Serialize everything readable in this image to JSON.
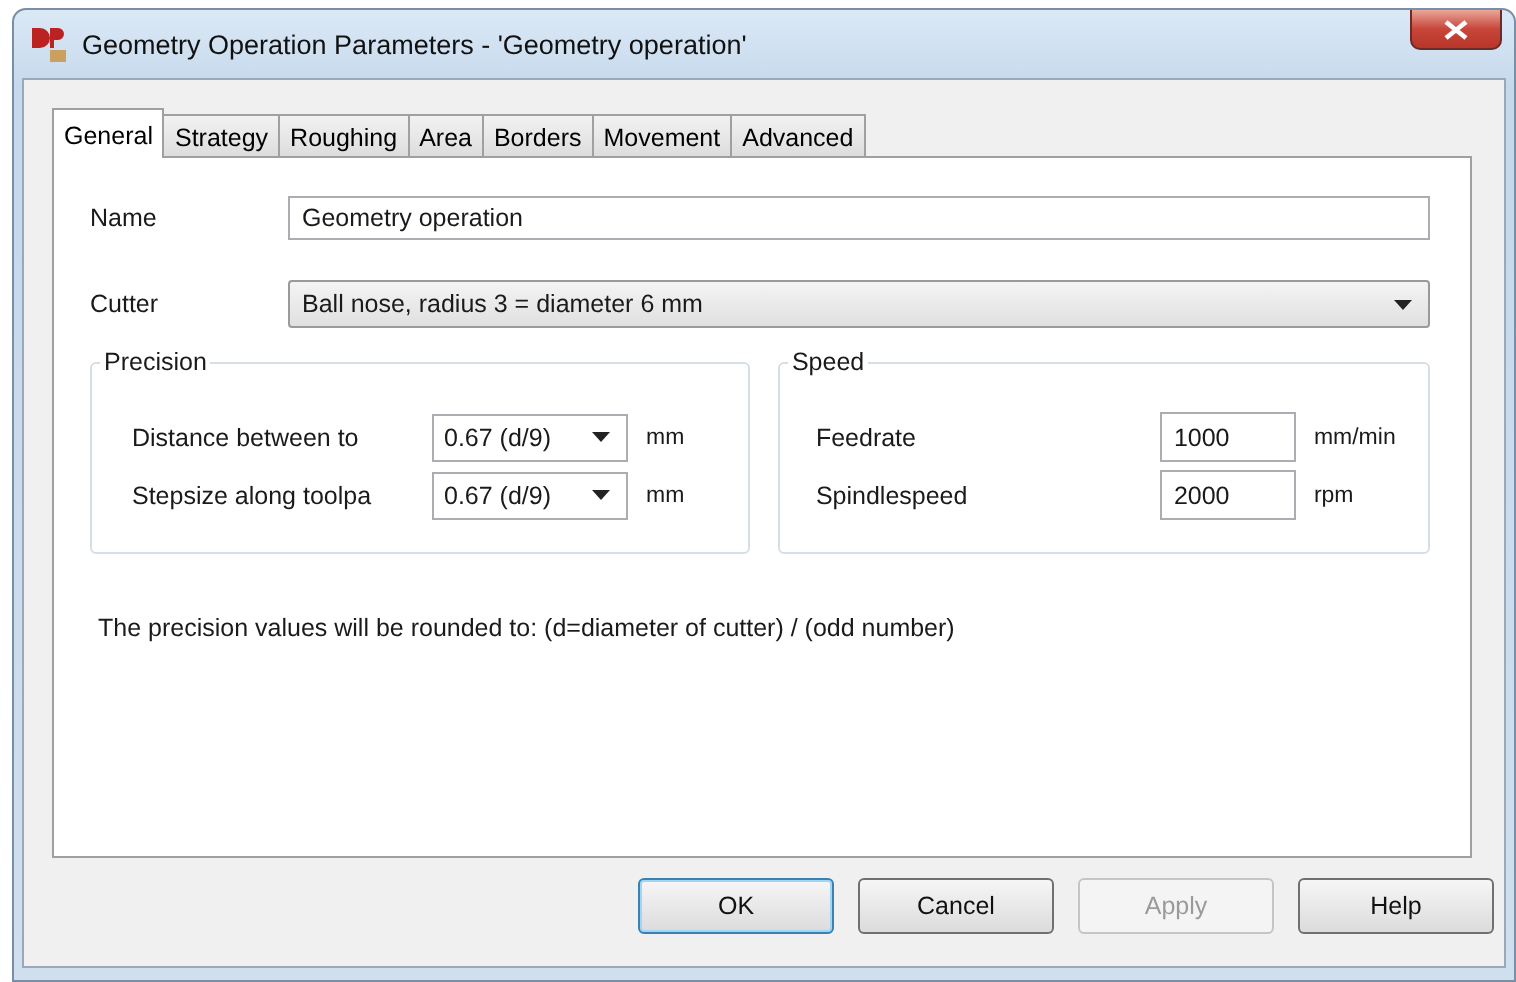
{
  "window": {
    "title": "Geometry Operation Parameters - 'Geometry operation'"
  },
  "tabs": [
    {
      "label": "General",
      "selected": true
    },
    {
      "label": "Strategy",
      "selected": false
    },
    {
      "label": "Roughing",
      "selected": false
    },
    {
      "label": "Area",
      "selected": false
    },
    {
      "label": "Borders",
      "selected": false
    },
    {
      "label": "Movement",
      "selected": false
    },
    {
      "label": "Advanced",
      "selected": false
    }
  ],
  "name": {
    "label": "Name",
    "value": "Geometry operation"
  },
  "cutter": {
    "label": "Cutter",
    "value": "Ball nose, radius 3 = diameter 6 mm"
  },
  "precision": {
    "title": "Precision",
    "rows": [
      {
        "label": "Distance between to",
        "value": "0.67  (d/9)",
        "unit": "mm"
      },
      {
        "label": "Stepsize along toolpa",
        "value": "0.67  (d/9)",
        "unit": "mm"
      }
    ]
  },
  "speed": {
    "title": "Speed",
    "rows": [
      {
        "label": "Feedrate",
        "value": "1000",
        "unit": "mm/min"
      },
      {
        "label": "Spindlespeed",
        "value": "2000",
        "unit": "rpm"
      }
    ]
  },
  "note": "The precision values will be rounded to:  (d=diameter of cutter) / (odd number)",
  "buttons": [
    {
      "label": "OK",
      "default": true,
      "disabled": false
    },
    {
      "label": "Cancel",
      "default": false,
      "disabled": false
    },
    {
      "label": "Apply",
      "default": false,
      "disabled": true
    },
    {
      "label": "Help",
      "default": false,
      "disabled": false
    }
  ]
}
